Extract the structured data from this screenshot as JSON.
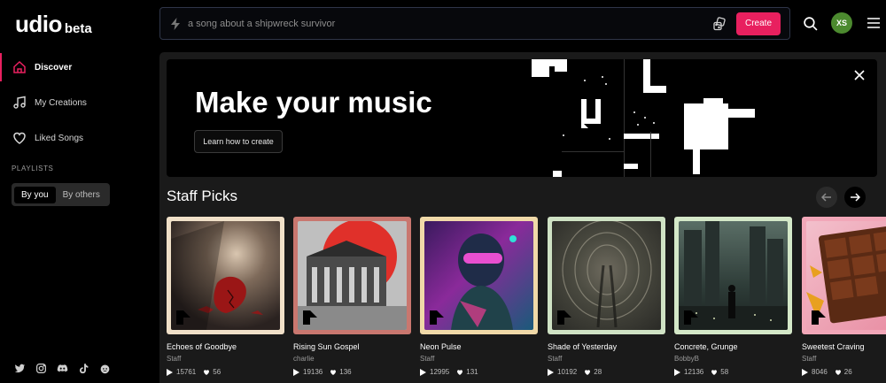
{
  "brand": {
    "name": "udio",
    "tag": "beta"
  },
  "nav": {
    "discover": "Discover",
    "creations": "My Creations",
    "liked": "Liked Songs"
  },
  "playlists": {
    "title": "PLAYLISTS",
    "by_you": "By you",
    "by_others": "By others"
  },
  "search": {
    "placeholder": "a song about a shipwreck survivor",
    "create_label": "Create"
  },
  "user": {
    "initials": "XS"
  },
  "hero": {
    "title": "Make your music",
    "button": "Learn how to create"
  },
  "section": {
    "title": "Staff Picks"
  },
  "cards": [
    {
      "title": "Echoes of Goodbye",
      "artist": "Staff",
      "plays": "15761",
      "likes": "56"
    },
    {
      "title": "Rising Sun Gospel",
      "artist": "charlie",
      "plays": "19136",
      "likes": "136"
    },
    {
      "title": "Neon Pulse",
      "artist": "Staff",
      "plays": "12995",
      "likes": "131"
    },
    {
      "title": "Shade of Yesterday",
      "artist": "Staff",
      "plays": "10192",
      "likes": "28"
    },
    {
      "title": "Concrete, Grunge",
      "artist": "BobbyB",
      "plays": "12136",
      "likes": "58"
    },
    {
      "title": "Sweetest Craving",
      "artist": "Staff",
      "plays": "8046",
      "likes": "26"
    }
  ],
  "colors": {
    "accent": "#e8205f",
    "avatar": "#4c8a2f",
    "card_frames": [
      "#f0e0c8",
      "#c9776f",
      "#f0d9a8",
      "#cfe2c4",
      "#d4e8c8",
      "#f2a7b8"
    ]
  }
}
